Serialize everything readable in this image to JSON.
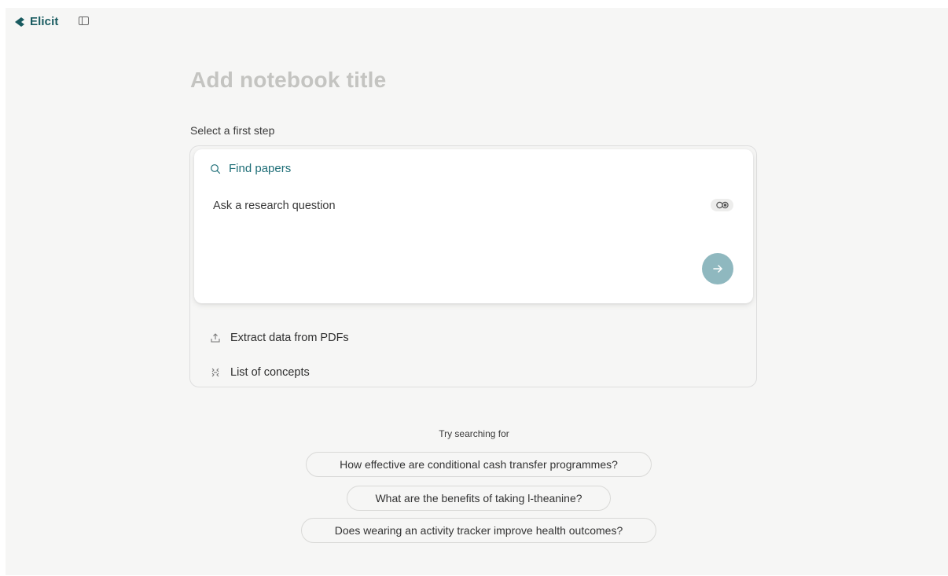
{
  "app": {
    "brand_name": "Elicit",
    "accent_color": "#1e6e77",
    "background_color": "#f6f6f5"
  },
  "notebook": {
    "title_placeholder": "Add notebook title"
  },
  "steps": {
    "label": "Select a first step",
    "active": {
      "label": "Find papers",
      "icon": "search-icon",
      "input_placeholder": "Ask a research question",
      "mode_icon": "toggle-mode-icon",
      "submit_icon": "arrow-right-icon",
      "submit_color": "#8fb8bf"
    },
    "options": [
      {
        "label": "Extract data from PDFs",
        "icon": "upload-icon"
      },
      {
        "label": "List of concepts",
        "icon": "concepts-icon"
      }
    ]
  },
  "suggestions": {
    "label": "Try searching for",
    "items": [
      "How effective are conditional cash transfer programmes?",
      "What are the benefits of taking l-theanine?",
      "Does wearing an activity tracker improve health outcomes?"
    ]
  }
}
